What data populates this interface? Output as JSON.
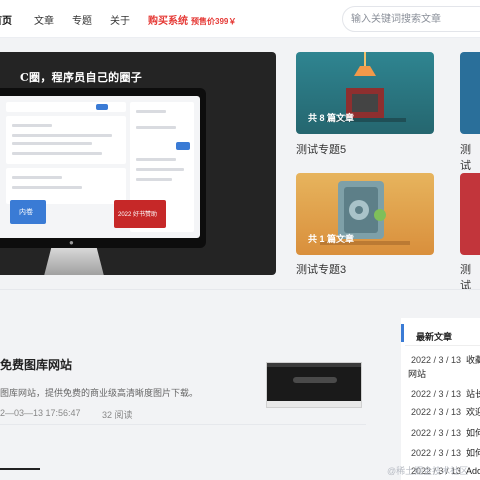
{
  "nav": {
    "home": "首页",
    "articles": "文章",
    "topics": "专题",
    "about": "关于",
    "buy": "购买系统",
    "buy_price": "预售价399￥",
    "search_placeholder": "输入关键词搜索文章"
  },
  "hero": {
    "title": "C圈，程序员自己的圈子",
    "screen_button": "内卷",
    "screen_banner": "2022 好书赞助"
  },
  "topics": [
    {
      "count": "共 8 篇文章",
      "title": "测试专题5",
      "color": "#2f7a86"
    },
    {
      "count": "共 1 篇文章",
      "title": "测试专题3",
      "color": "#e0a34a"
    },
    {
      "title": "测试",
      "color": "#2a6f9a"
    },
    {
      "title": "测试",
      "color": "#c2353b"
    }
  ],
  "article": {
    "title": "免费图库网站",
    "description": "图库网站，提供免费的商业级高清晰度图片下载。",
    "date": "2—03—13 17:56:47",
    "reads": "32 阅读"
  },
  "sidebar": {
    "title": "最新文章",
    "items": [
      {
        "date": "2022 / 3 / 13",
        "title": "收藏"
      },
      {
        "date": "",
        "title": "网站"
      },
      {
        "date": "2022 / 3 / 13",
        "title": "站长"
      },
      {
        "date": "2022 / 3 / 13",
        "title": "欢迎"
      },
      {
        "date": "2022 / 3 / 13",
        "title": "如何"
      },
      {
        "date": "2022 / 3 / 13",
        "title": "如何"
      },
      {
        "date": "2022 / 3 / 13",
        "title": "Ado"
      }
    ]
  },
  "watermark": "@稀土掘金技术社区"
}
